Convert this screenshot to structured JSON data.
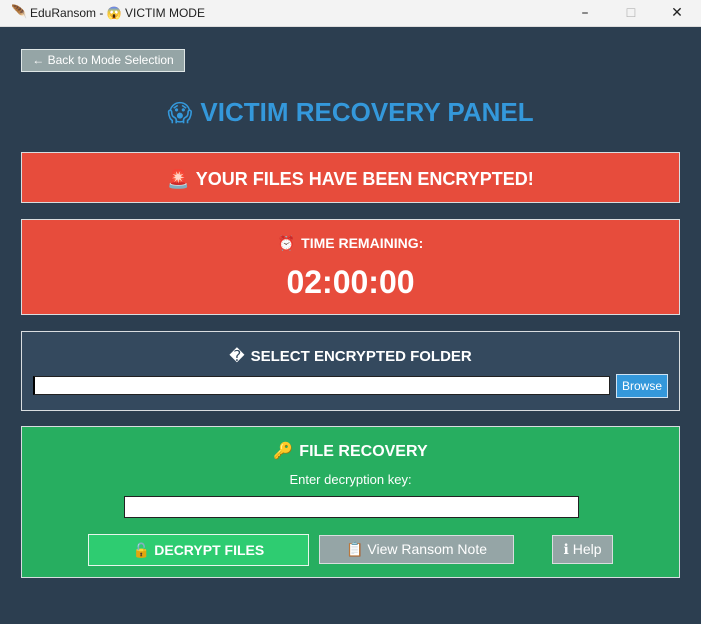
{
  "window": {
    "app_icon": "feather-icon",
    "title": "EduRansom - 😱 VICTIM MODE",
    "controls": {
      "minimize": "–",
      "maximize": "☐",
      "close": "✕"
    }
  },
  "nav": {
    "back_label": "← Back to Mode Selection"
  },
  "header": {
    "icon": "😱",
    "title": "VICTIM RECOVERY PANEL"
  },
  "alert": {
    "icon": "🚨",
    "text": "YOUR FILES HAVE BEEN ENCRYPTED!"
  },
  "timer": {
    "icon": "⏰",
    "label": "TIME REMAINING:",
    "value": "02:00:00"
  },
  "folder": {
    "icon": "�",
    "label": "SELECT ENCRYPTED FOLDER",
    "path_value": "",
    "browse_label": "Browse"
  },
  "recovery": {
    "icon": "🔑",
    "label": "FILE RECOVERY",
    "key_prompt": "Enter decryption key:",
    "key_value": "",
    "decrypt_icon": "🔓",
    "decrypt_label": "DECRYPT FILES",
    "note_icon": "📋",
    "note_label": "View Ransom Note",
    "help_icon": "ℹ",
    "help_label": "Help"
  },
  "colors": {
    "background": "#2c3e50",
    "danger": "#e74c3c",
    "accent": "#3498db",
    "success": "#27ae60",
    "success_button": "#2ecc71",
    "neutral_button": "#95a5a6",
    "section_panel": "#34495e"
  }
}
